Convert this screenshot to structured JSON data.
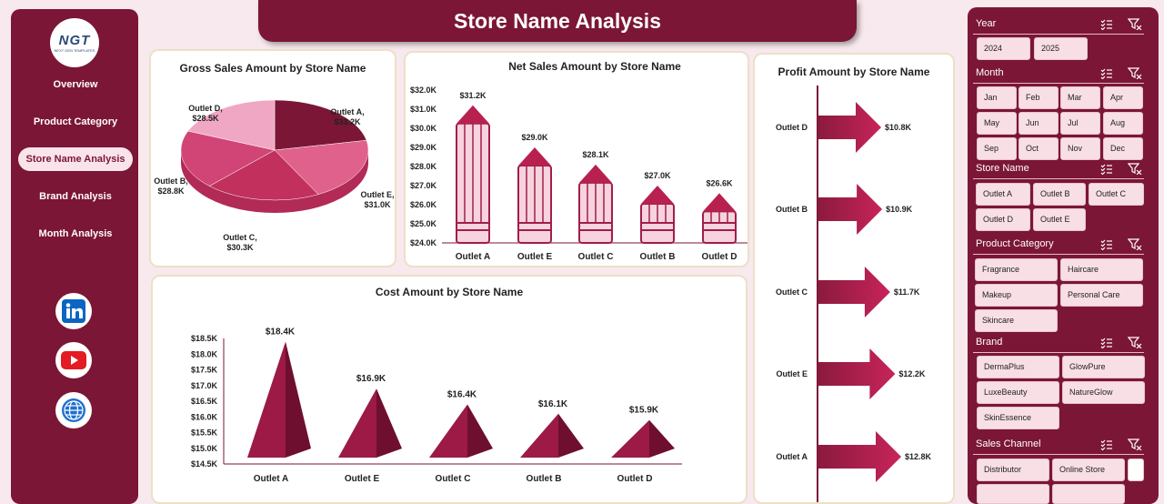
{
  "header": {
    "title": "Store Name Analysis"
  },
  "logo": {
    "text": "NGT",
    "subtext": "NEXT GEN TEMPLATES"
  },
  "nav": [
    "Overview",
    "Product Category",
    "Store Name Analysis",
    "Brand Analysis",
    "Month Analysis"
  ],
  "nav_active": "Store Name Analysis",
  "social": [
    "linkedin-icon",
    "youtube-icon",
    "globe-icon"
  ],
  "colors": {
    "primary": "#7b1636",
    "accent": "#b8214f",
    "light": "#f8e4ea",
    "background": "#f8e9ee"
  },
  "slicers": {
    "year": {
      "title": "Year",
      "items": [
        "2024",
        "2025"
      ]
    },
    "month": {
      "title": "Month",
      "items": [
        "Jan",
        "Feb",
        "Mar",
        "Apr",
        "May",
        "Jun",
        "Jul",
        "Aug",
        "Sep",
        "Oct",
        "Nov",
        "Dec"
      ]
    },
    "store": {
      "title": "Store Name",
      "items": [
        "Outlet A",
        "Outlet B",
        "Outlet C",
        "Outlet D",
        "Outlet E"
      ]
    },
    "category": {
      "title": "Product Category",
      "items": [
        "Fragrance",
        "Haircare",
        "Makeup",
        "Personal Care",
        "Skincare"
      ]
    },
    "brand": {
      "title": "Brand",
      "items": [
        "DermaPlus",
        "GlowPure",
        "LuxeBeauty",
        "NatureGlow",
        "SkinEssence"
      ]
    },
    "channel": {
      "title": "Sales Channel",
      "items": [
        "Distributor",
        "Online Store"
      ]
    }
  },
  "chart_data": [
    {
      "type": "pie",
      "title": "Gross Sales Amount by Store Name",
      "categories": [
        "Outlet A",
        "Outlet E",
        "Outlet C",
        "Outlet B",
        "Outlet D"
      ],
      "values": [
        33.2,
        31.0,
        30.3,
        28.8,
        28.5
      ],
      "labels": [
        "$33.2K",
        "$31.0K",
        "$30.3K",
        "$28.8K",
        "$28.5K"
      ],
      "colors": [
        "#7b1636",
        "#e0628c",
        "#c2305e",
        "#d14576",
        "#f0a7c3"
      ]
    },
    {
      "type": "bar",
      "title": "Net Sales Amount by Store Name",
      "categories": [
        "Outlet A",
        "Outlet E",
        "Outlet C",
        "Outlet B",
        "Outlet D"
      ],
      "values": [
        31.2,
        29.0,
        28.1,
        27.0,
        26.6
      ],
      "labels": [
        "$31.2K",
        "$29.0K",
        "$28.1K",
        "$27.0K",
        "$26.6K"
      ],
      "ylim": [
        24,
        32
      ],
      "yticks": [
        "$24.0K",
        "$25.0K",
        "$26.0K",
        "$27.0K",
        "$28.0K",
        "$29.0K",
        "$30.0K",
        "$31.0K",
        "$32.0K"
      ]
    },
    {
      "type": "bar",
      "title": "Profit Amount by Store Name",
      "orientation": "horizontal",
      "categories": [
        "Outlet D",
        "Outlet B",
        "Outlet C",
        "Outlet E",
        "Outlet A"
      ],
      "values": [
        10.8,
        10.9,
        11.7,
        12.2,
        12.8
      ],
      "labels": [
        "$10.8K",
        "$10.9K",
        "$11.7K",
        "$12.2K",
        "$12.8K"
      ]
    },
    {
      "type": "bar",
      "title": "Cost Amount by Store Name",
      "categories": [
        "Outlet A",
        "Outlet E",
        "Outlet C",
        "Outlet B",
        "Outlet D"
      ],
      "values": [
        18.4,
        16.9,
        16.4,
        16.1,
        15.9
      ],
      "labels": [
        "$18.4K",
        "$16.9K",
        "$16.4K",
        "$16.1K",
        "$15.9K"
      ],
      "ylim": [
        14.5,
        18.5
      ],
      "yticks": [
        "$14.5K",
        "$15.0K",
        "$15.5K",
        "$16.0K",
        "$16.5K",
        "$17.0K",
        "$17.5K",
        "$18.0K",
        "$18.5K"
      ]
    }
  ]
}
